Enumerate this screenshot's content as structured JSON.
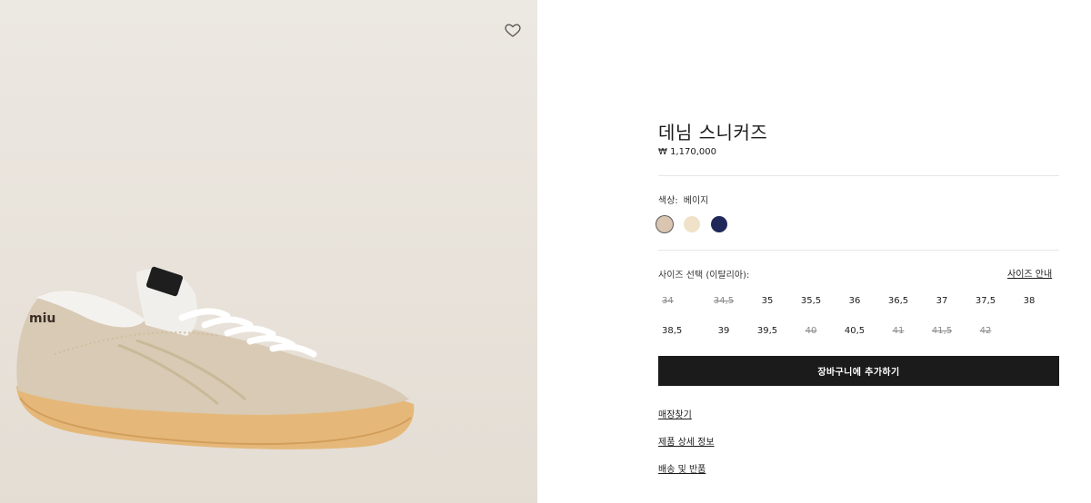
{
  "product": {
    "name": "데님 스니커즈",
    "price": "₩ 1,170,000"
  },
  "gallery": {
    "wishlist_icon": "heart-outline-icon",
    "image_label": "miu"
  },
  "color": {
    "label": "색상:",
    "selected_name": "베이지",
    "swatches": [
      {
        "name": "베이지",
        "hex": "#d9c5b0",
        "selected": true
      },
      {
        "name": "크림",
        "hex": "#f0e2c8",
        "selected": false
      },
      {
        "name": "네이비",
        "hex": "#1f2858",
        "selected": false
      }
    ]
  },
  "size": {
    "label": "사이즈 선택 (이탈리아):",
    "guide_label": "사이즈 안내",
    "row1": [
      {
        "value": "34",
        "available": false
      },
      {
        "value": "34,5",
        "available": false
      },
      {
        "value": "35",
        "available": true
      },
      {
        "value": "35,5",
        "available": true
      },
      {
        "value": "36",
        "available": true
      },
      {
        "value": "36,5",
        "available": true
      },
      {
        "value": "37",
        "available": true
      },
      {
        "value": "37,5",
        "available": true
      },
      {
        "value": "38",
        "available": true
      }
    ],
    "row2": [
      {
        "value": "38,5",
        "available": true
      },
      {
        "value": "39",
        "available": true
      },
      {
        "value": "39,5",
        "available": true
      },
      {
        "value": "40",
        "available": false
      },
      {
        "value": "40,5",
        "available": true
      },
      {
        "value": "41",
        "available": false
      },
      {
        "value": "41,5",
        "available": false
      },
      {
        "value": "42",
        "available": false
      }
    ]
  },
  "actions": {
    "add_to_cart": "장바구니에 추가하기"
  },
  "links": {
    "find_store": "매장찾기",
    "product_details": "제품 상세 정보",
    "shipping_returns": "배송 및 반품"
  }
}
